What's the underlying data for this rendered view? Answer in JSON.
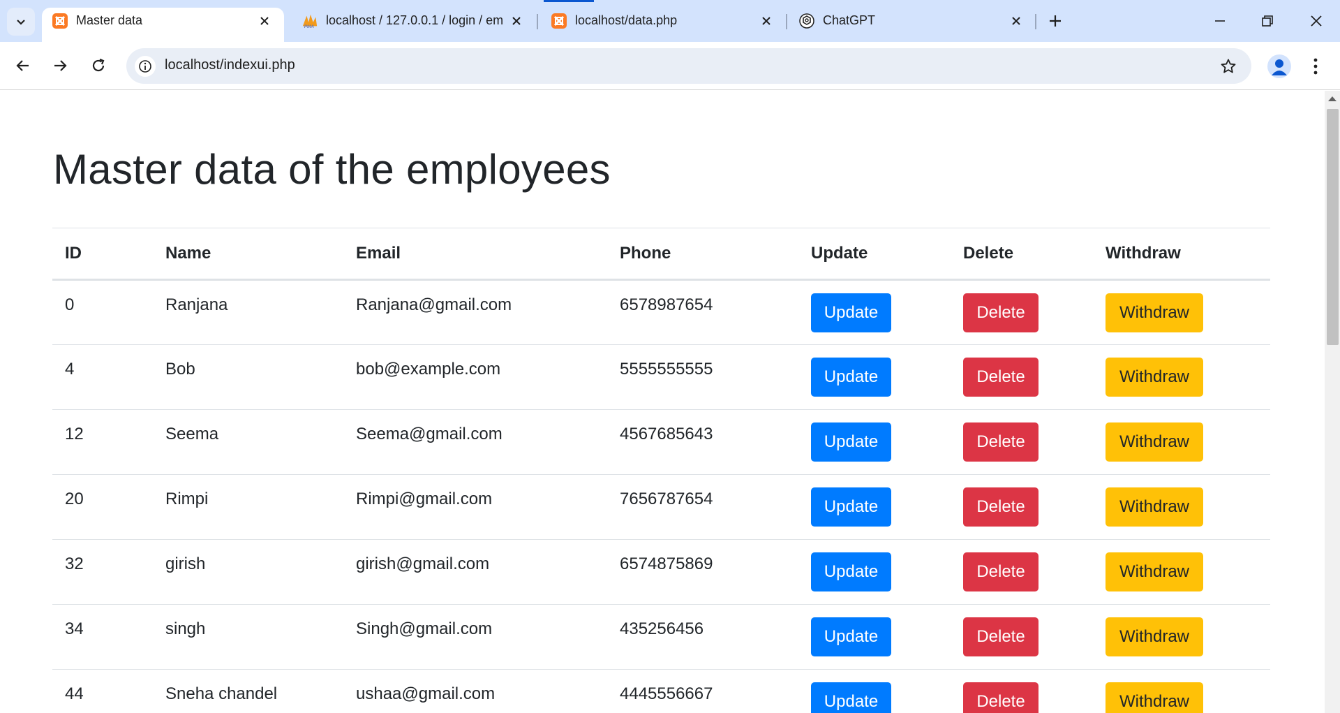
{
  "browser": {
    "tabs": [
      {
        "title": "Master data",
        "active": true,
        "icon": "xampp-icon"
      },
      {
        "title": "localhost / 127.0.0.1 / login / em",
        "active": false,
        "icon": "phpmyadmin-icon"
      },
      {
        "title": "localhost/data.php",
        "active": false,
        "icon": "xampp-icon"
      },
      {
        "title": "ChatGPT",
        "active": false,
        "icon": "chatgpt-icon"
      }
    ],
    "url": "localhost/indexui.php"
  },
  "page": {
    "title": "Master data of the employees",
    "columns": [
      "ID",
      "Name",
      "Email",
      "Phone",
      "Update",
      "Delete",
      "Withdraw"
    ],
    "button_labels": {
      "update": "Update",
      "delete": "Delete",
      "withdraw": "Withdraw"
    },
    "rows": [
      {
        "id": "0",
        "name": "Ranjana",
        "email": "Ranjana@gmail.com",
        "phone": "6578987654"
      },
      {
        "id": "4",
        "name": "Bob",
        "email": "bob@example.com",
        "phone": "5555555555"
      },
      {
        "id": "12",
        "name": "Seema",
        "email": "Seema@gmail.com",
        "phone": "4567685643"
      },
      {
        "id": "20",
        "name": "Rimpi",
        "email": "Rimpi@gmail.com",
        "phone": "7656787654"
      },
      {
        "id": "32",
        "name": "girish",
        "email": "girish@gmail.com",
        "phone": "6574875869"
      },
      {
        "id": "34",
        "name": "singh",
        "email": "Singh@gmail.com",
        "phone": "435256456"
      },
      {
        "id": "44",
        "name": "Sneha chandel",
        "email": "ushaa@gmail.com",
        "phone": "4445556667"
      }
    ]
  },
  "colors": {
    "update": "#007bff",
    "delete": "#dc3545",
    "withdraw": "#ffc107",
    "tabstrip": "#d3e3fd"
  }
}
